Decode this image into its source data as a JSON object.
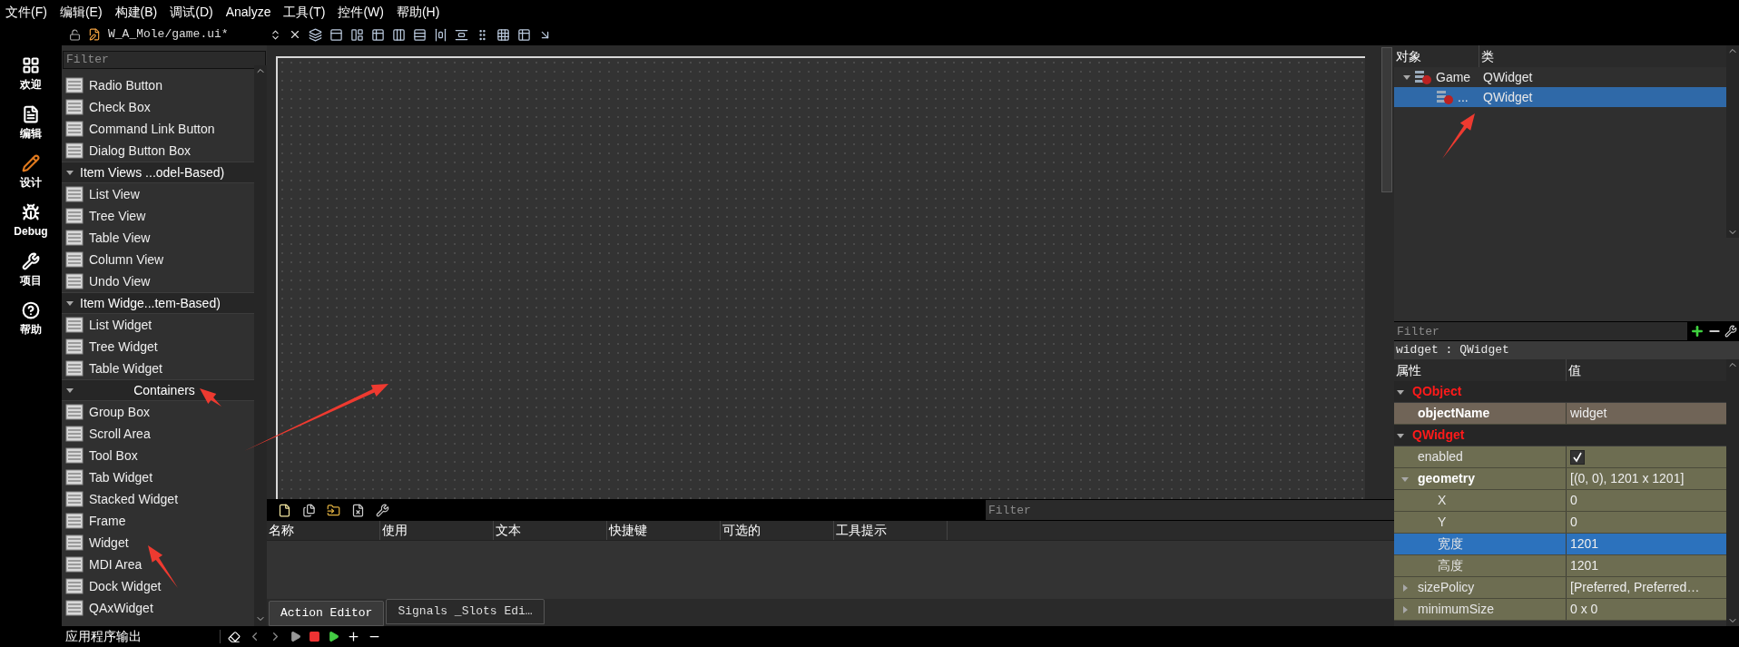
{
  "menu": [
    "文件(F)",
    "编辑(E)",
    "构建(B)",
    "调试(D)",
    "Analyze",
    "工具(T)",
    "控件(W)",
    "帮助(H)"
  ],
  "toolbar": {
    "file": "W_A_Mole/game.ui*"
  },
  "modes": [
    {
      "label": "欢迎"
    },
    {
      "label": "编辑"
    },
    {
      "label": "设计"
    },
    {
      "label": "Debug"
    },
    {
      "label": "项目"
    },
    {
      "label": "帮助"
    }
  ],
  "widget_box": {
    "filter": {
      "placeholder": "Filter"
    },
    "items": [
      {
        "kind": "widget",
        "label": "Radio Button"
      },
      {
        "kind": "widget",
        "label": "Check Box"
      },
      {
        "kind": "widget",
        "label": "Command Link Button"
      },
      {
        "kind": "widget",
        "label": "Dialog Button Box"
      },
      {
        "kind": "category",
        "label": "Item Views ...odel-Based)",
        "centered": false
      },
      {
        "kind": "widget",
        "label": "List View"
      },
      {
        "kind": "widget",
        "label": "Tree View"
      },
      {
        "kind": "widget",
        "label": "Table View"
      },
      {
        "kind": "widget",
        "label": "Column View"
      },
      {
        "kind": "widget",
        "label": "Undo View"
      },
      {
        "kind": "category",
        "label": "Item Widge...tem-Based)",
        "centered": false
      },
      {
        "kind": "widget",
        "label": "List Widget"
      },
      {
        "kind": "widget",
        "label": "Tree Widget"
      },
      {
        "kind": "widget",
        "label": "Table Widget"
      },
      {
        "kind": "category",
        "label": "Containers",
        "centered": true
      },
      {
        "kind": "widget",
        "label": "Group Box"
      },
      {
        "kind": "widget",
        "label": "Scroll Area"
      },
      {
        "kind": "widget",
        "label": "Tool Box"
      },
      {
        "kind": "widget",
        "label": "Tab Widget"
      },
      {
        "kind": "widget",
        "label": "Stacked Widget"
      },
      {
        "kind": "widget",
        "label": "Frame"
      },
      {
        "kind": "widget",
        "label": "Widget"
      },
      {
        "kind": "widget",
        "label": "MDI Area"
      },
      {
        "kind": "widget",
        "label": "Dock Widget"
      },
      {
        "kind": "widget",
        "label": "QAxWidget"
      }
    ]
  },
  "action_editor": {
    "filter": {
      "placeholder": "Filter"
    },
    "columns": [
      "名称",
      "使用",
      "文本",
      "快捷键",
      "可选的",
      "工具提示"
    ],
    "tabs": [
      {
        "label": "Action Editor",
        "selected": true
      },
      {
        "label": "Signals _Slots Edi…",
        "selected": false
      }
    ]
  },
  "status_bar": {
    "label": "应用程序输出"
  },
  "object_inspector": {
    "columns": [
      "对象",
      "类"
    ],
    "tree": [
      {
        "object": "Game",
        "class": "QWidget",
        "selected": false,
        "expanded": true,
        "children": [
          {
            "object": "...",
            "class": "QWidget",
            "selected": true
          }
        ]
      }
    ],
    "filter": {
      "placeholder": "Filter"
    }
  },
  "property_editor": {
    "title": "widget : QWidget",
    "columns": [
      "属性",
      "值"
    ],
    "groups": [
      {
        "name": "QObject",
        "expanded": true,
        "color": "#706457",
        "properties": [
          {
            "name": "objectName",
            "value": "widget",
            "modified": true,
            "selected": false
          }
        ]
      },
      {
        "name": "QWidget",
        "expanded": true,
        "color": "#6d6d51",
        "properties": [
          {
            "name": "enabled",
            "kind": "checkbox",
            "checked": true,
            "modified": false,
            "selected": false
          },
          {
            "name": "geometry",
            "value": "[(0, 0), 1201 x 1201]",
            "modified": true,
            "selected": false,
            "expanded": true,
            "children": [
              {
                "name": "X",
                "value": "0",
                "selected": false
              },
              {
                "name": "Y",
                "value": "0",
                "selected": false
              },
              {
                "name": "宽度",
                "value": "1201",
                "selected": true
              },
              {
                "name": "高度",
                "value": "1201",
                "selected": false
              }
            ]
          },
          {
            "name": "sizePolicy",
            "value": "[Preferred, Preferred…",
            "modified": false,
            "selected": false,
            "expanded": false
          },
          {
            "name": "minimumSize",
            "value": "0 x 0",
            "modified": false,
            "selected": false,
            "expanded": false
          }
        ]
      }
    ]
  }
}
